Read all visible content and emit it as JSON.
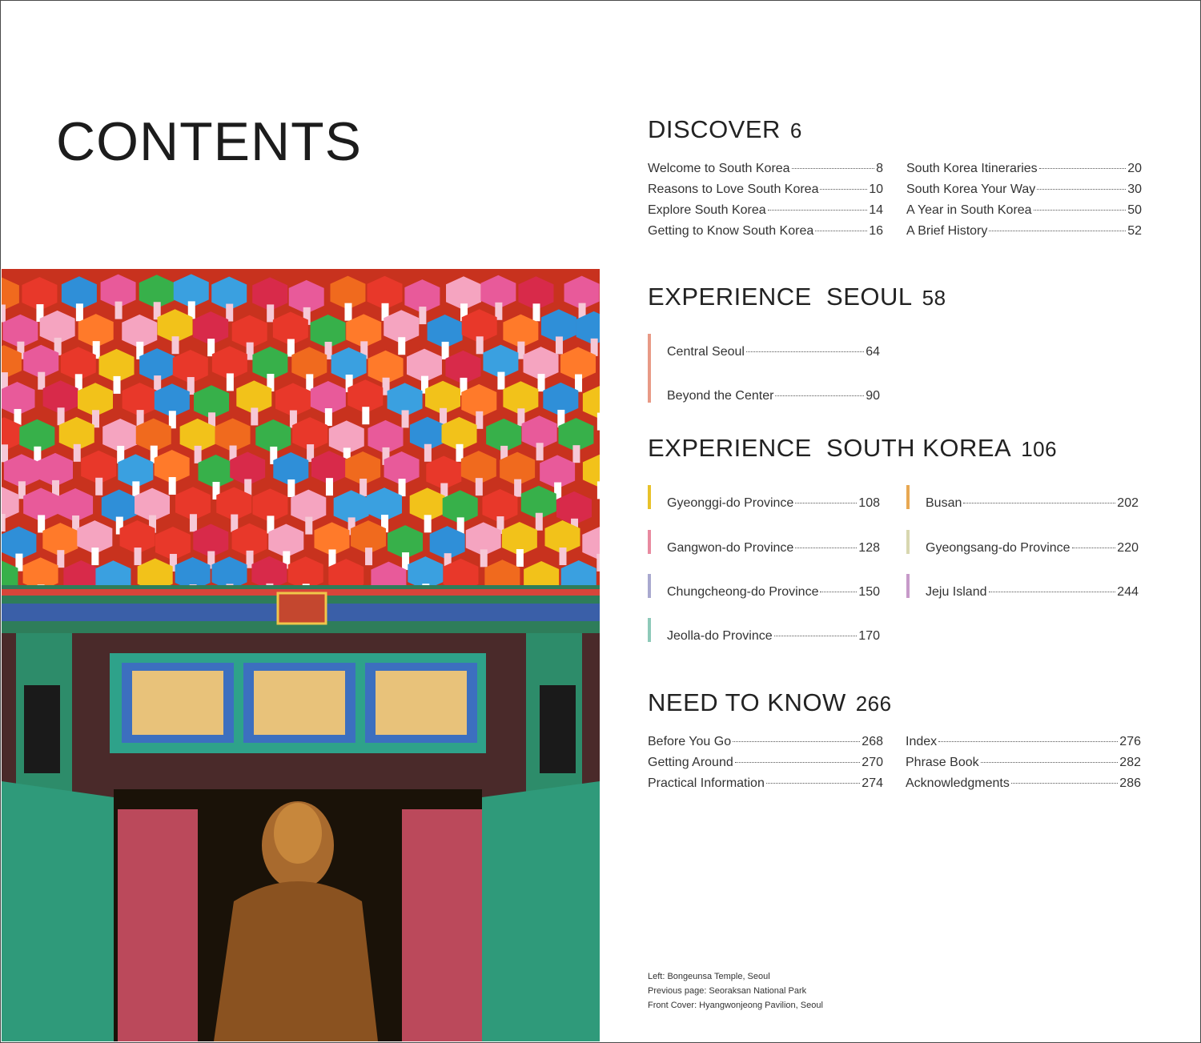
{
  "title": "CONTENTS",
  "discover": {
    "heading": "DISCOVER",
    "page": "6",
    "left": [
      {
        "label": "Welcome to South Korea",
        "page": "8"
      },
      {
        "label": "Reasons to Love South Korea",
        "page": "10"
      },
      {
        "label": "Explore South Korea",
        "page": "14"
      },
      {
        "label": "Getting to Know South Korea",
        "page": "16"
      }
    ],
    "right": [
      {
        "label": "South Korea Itineraries",
        "page": "20"
      },
      {
        "label": "South Korea Your Way",
        "page": "30"
      },
      {
        "label": "A Year in South Korea",
        "page": "50"
      },
      {
        "label": "A Brief History",
        "page": "52"
      }
    ]
  },
  "seoul": {
    "heading": "EXPERIENCE  SEOUL",
    "page": "58",
    "accent": "#e89a86",
    "items": [
      {
        "label": "Central Seoul",
        "page": "64"
      },
      {
        "label": "Beyond the Center",
        "page": "90"
      }
    ]
  },
  "korea": {
    "heading": "EXPERIENCE  SOUTH KOREA",
    "page": "106",
    "left": [
      {
        "label": "Gyeonggi-do Province",
        "page": "108",
        "color": "#e8c22a"
      },
      {
        "label": "Gangwon-do Province",
        "page": "128",
        "color": "#e88aa0"
      },
      {
        "label": "Chungcheong-do Province",
        "page": "150",
        "color": "#a9a9cf"
      },
      {
        "label": "Jeolla-do Province",
        "page": "170",
        "color": "#8ec9b9"
      }
    ],
    "right": [
      {
        "label": "Busan",
        "page": "202",
        "color": "#e8a852"
      },
      {
        "label": "Gyeongsang-do Province",
        "page": "220",
        "color": "#d8d7b0"
      },
      {
        "label": "Jeju Island",
        "page": "244",
        "color": "#c79ac9"
      }
    ]
  },
  "need": {
    "heading": "NEED TO KNOW",
    "page": "266",
    "left": [
      {
        "label": "Before You Go",
        "page": "268"
      },
      {
        "label": "Getting Around",
        "page": "270"
      },
      {
        "label": "Practical Information",
        "page": "274"
      }
    ],
    "right": [
      {
        "label": "Index",
        "page": "276"
      },
      {
        "label": "Phrase Book",
        "page": "282"
      },
      {
        "label": "Acknowledgments",
        "page": "286"
      }
    ]
  },
  "credits": [
    "Left: Bongeunsa Temple, Seoul",
    "Previous page: Seoraksan National Park",
    "Front Cover: Hyangwonjeong Pavilion, Seoul"
  ]
}
